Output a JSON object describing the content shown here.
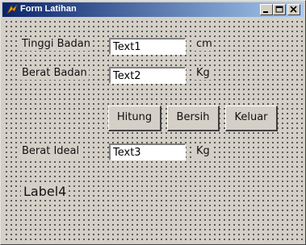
{
  "window": {
    "title": "Form Latihan"
  },
  "form": {
    "tinggi_label": "Tinggi Badan",
    "tinggi_value": "Text1",
    "tinggi_unit": "cm",
    "berat_label": "Berat Badan",
    "berat_value": "Text2",
    "berat_unit": "Kg",
    "ideal_label": "Berat Ideal",
    "ideal_value": "Text3",
    "ideal_unit": "Kg",
    "result_label": "Label4"
  },
  "buttons": {
    "hitung": "Hitung",
    "bersih": "Bersih",
    "keluar": "Keluar"
  }
}
